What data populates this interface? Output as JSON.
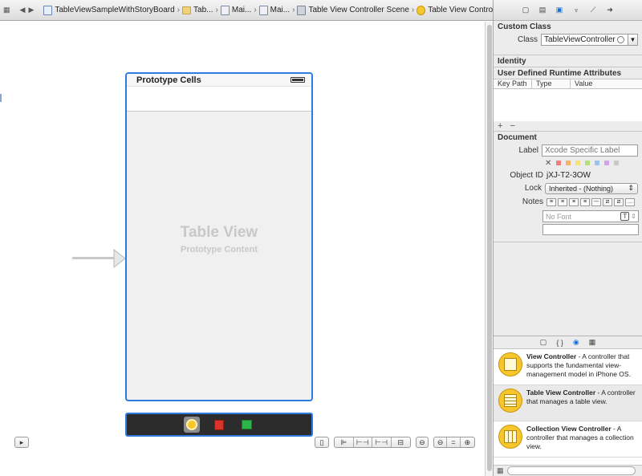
{
  "jumpbar": {
    "crumbs": [
      {
        "label": "TableViewSampleWithStoryBoard"
      },
      {
        "label": "Tab..."
      },
      {
        "label": "Mai..."
      },
      {
        "label": "Mai..."
      },
      {
        "label": "Table View Controller Scene"
      },
      {
        "label": "Table View Controller"
      }
    ]
  },
  "scene": {
    "prototype_title": "Prototype Cells",
    "table_view_title": "Table View",
    "table_view_subtitle": "Prototype Content"
  },
  "inspector": {
    "custom_class_header": "Custom Class",
    "class_label": "Class",
    "class_value": "TableViewController",
    "identity_header": "Identity",
    "runtime_attrs_header": "User Defined Runtime Attributes",
    "columns": [
      "Key Path",
      "Type",
      "Value"
    ],
    "plus": "+",
    "minus": "−",
    "document_header": "Document",
    "label_label": "Label",
    "label_placeholder": "Xcode Specific Label",
    "object_id_label": "Object ID",
    "object_id_value": "jXJ-T2-3OW",
    "lock_label": "Lock",
    "lock_value": "Inherited - (Nothing)",
    "notes_label": "Notes",
    "font_placeholder": "No Font",
    "swatch_colors": [
      "#f08080",
      "#f3b46a",
      "#f2e27a",
      "#b6e07a",
      "#9dc4ef",
      "#d4a2ea",
      "#c9c9c9"
    ]
  },
  "library": {
    "items": [
      {
        "title": "View Controller",
        "desc": " - A controller that supports the fundamental view-management model in iPhone OS."
      },
      {
        "title": "Table View Controller",
        "desc": " - A controller that manages a table view."
      },
      {
        "title": "Collection View Controller",
        "desc": " - A controller that manages a collection view."
      }
    ]
  }
}
